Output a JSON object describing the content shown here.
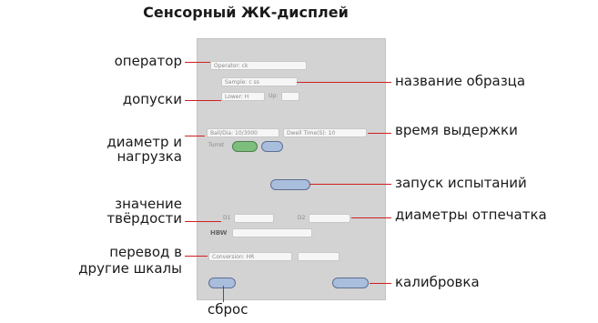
{
  "title": "Сенсорный ЖК-дисплей",
  "labels": {
    "operator": "оператор",
    "tolerances": "допуски",
    "diameter_load_1": "диаметр и",
    "diameter_load_2": "нагрузка",
    "hardness_1": "значение",
    "hardness_2": "твёрдости",
    "conversion_1": "перевод в",
    "conversion_2": "другие шкалы",
    "reset": "сброс",
    "sample_name": "название образца",
    "dwell_time": "время выдержки",
    "test_start": "запуск испытаний",
    "indent_diameters": "диаметры отпечатка",
    "calibration": "калибровка"
  },
  "screen": {
    "operator_field": "Operator: ck",
    "sample_field": "Sample: c ss",
    "lower_field": "Lower: H",
    "upper_label": "Up:",
    "ball_load": "Ball/Dia: 10/3000",
    "dwell": "Dwell Time(S): 10",
    "turret": "Turret",
    "d1_label": "D1",
    "d2_label": "D2",
    "hbw": "HBW",
    "conv": "Conversion: HR",
    "colors": {
      "panel": "#d3d3d3",
      "button_blue": "#a9bddc",
      "button_green": "#7dbe7d",
      "leader": "#d02020"
    }
  }
}
